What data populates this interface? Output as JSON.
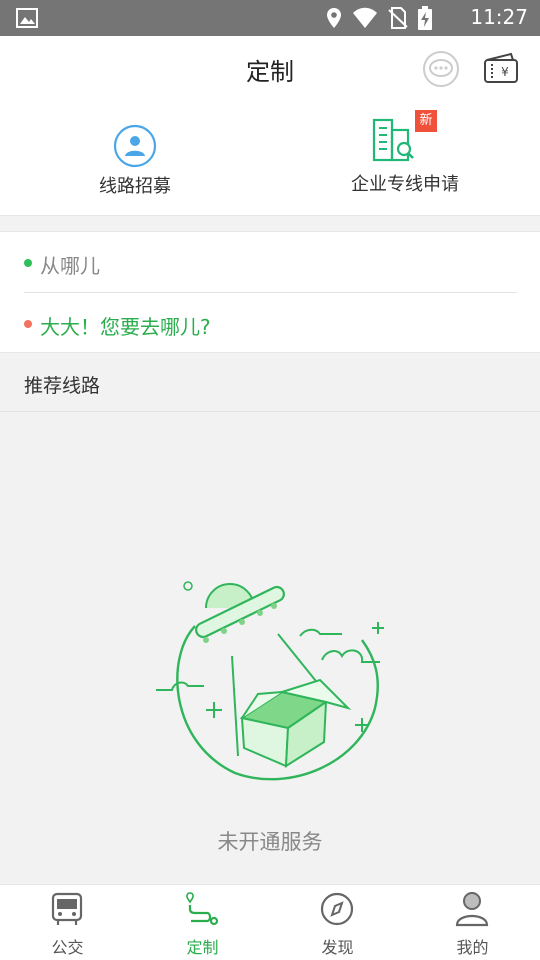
{
  "status_bar": {
    "time": "11:27",
    "icons": [
      "image-icon",
      "location-icon",
      "wifi-icon",
      "no-sim-icon",
      "battery-charging-icon"
    ]
  },
  "header": {
    "title": "定制",
    "icons": [
      "message-icon",
      "wallet-icon"
    ]
  },
  "quick_actions": [
    {
      "label": "线路招募",
      "icon": "person-circle-icon"
    },
    {
      "label": "企业专线申请",
      "icon": "building-search-icon",
      "badge": "新"
    }
  ],
  "route_input": {
    "from_placeholder": "从哪儿",
    "to_prompt": "大大！您要去哪儿?"
  },
  "recommended": {
    "title": "推荐线路",
    "empty_text": "未开通服务"
  },
  "tabs": [
    {
      "label": "公交",
      "icon": "bus-icon",
      "active": false
    },
    {
      "label": "定制",
      "icon": "route-icon",
      "active": true
    },
    {
      "label": "发现",
      "icon": "compass-icon",
      "active": false
    },
    {
      "label": "我的",
      "icon": "user-icon",
      "active": false
    }
  ],
  "colors": {
    "accent": "#2aae4d",
    "status_bar": "#757575",
    "badge": "#f0513b",
    "to_dot": "#f0725f"
  }
}
